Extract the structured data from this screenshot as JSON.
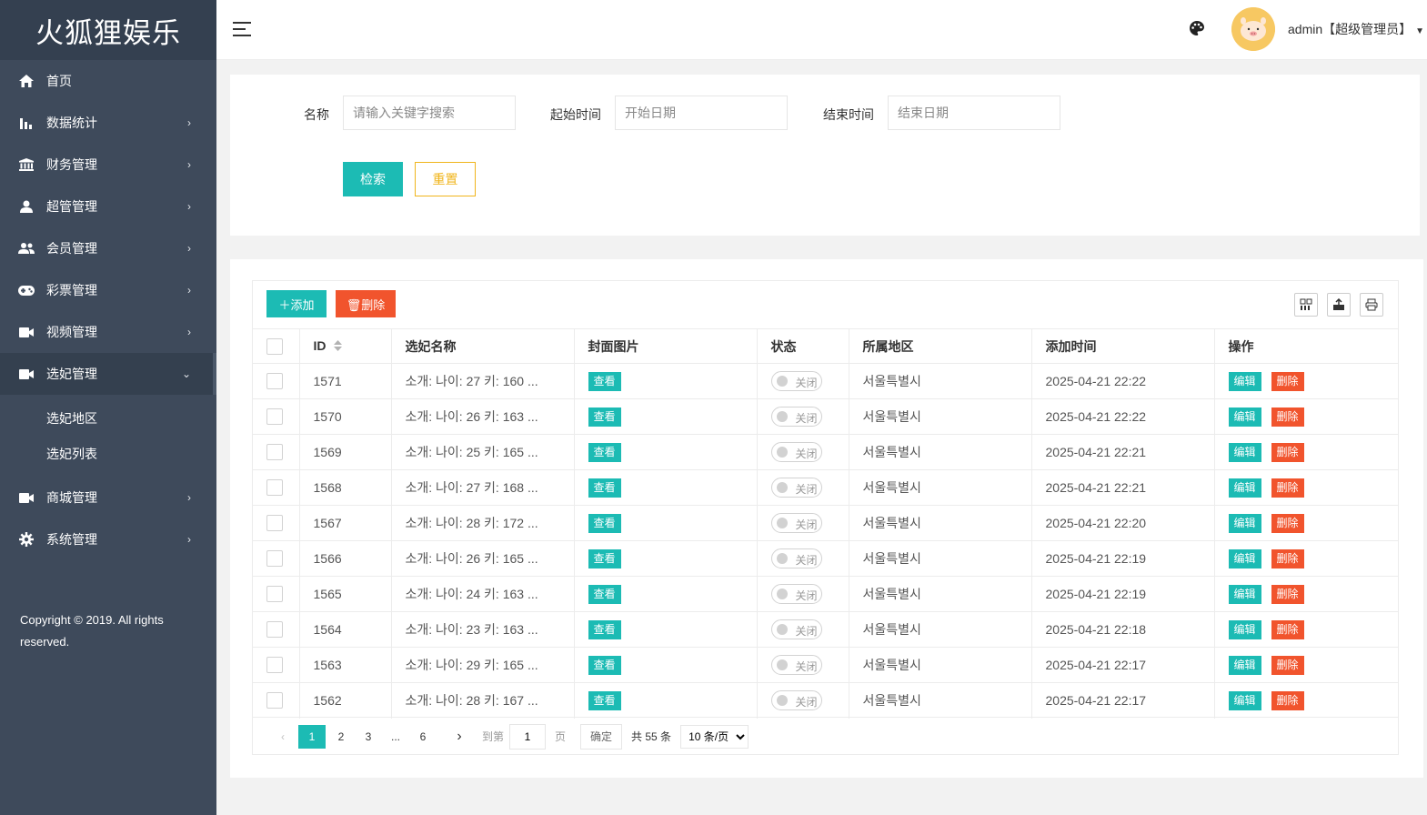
{
  "brand": {
    "title": "火狐狸娱乐"
  },
  "sidebar": {
    "items": [
      {
        "label": "首页",
        "icon": "home-icon"
      },
      {
        "label": "数据统计",
        "icon": "bar-chart-icon"
      },
      {
        "label": "财务管理",
        "icon": "bank-icon"
      },
      {
        "label": "超管管理",
        "icon": "user-icon"
      },
      {
        "label": "会员管理",
        "icon": "users-icon"
      },
      {
        "label": "彩票管理",
        "icon": "gamepad-icon"
      },
      {
        "label": "视频管理",
        "icon": "video-icon"
      },
      {
        "label": "选妃管理",
        "icon": "video-icon"
      }
    ],
    "sub_items": [
      {
        "label": "选妃地区"
      },
      {
        "label": "选妃列表"
      }
    ],
    "items_after": [
      {
        "label": "商城管理",
        "icon": "video-icon"
      },
      {
        "label": "系统管理",
        "icon": "gear-icon"
      }
    ],
    "copyright": "Copyright © 2019. All rights reserved."
  },
  "header": {
    "user": "admin【超级管理员】"
  },
  "search": {
    "name_label": "名称",
    "name_placeholder": "请输入关键字搜索",
    "start_label": "起始时间",
    "start_placeholder": "开始日期",
    "end_label": "结束时间",
    "end_placeholder": "结束日期",
    "search_button": "检索",
    "reset_button": "重置"
  },
  "toolbar": {
    "add_label": "添加",
    "delete_label": "删除"
  },
  "table": {
    "columns": [
      "ID",
      "选妃名称",
      "封面图片",
      "状态",
      "所属地区",
      "添加时间",
      "操作"
    ],
    "view_label": "查看",
    "status_label": "关闭",
    "edit_label": "编辑",
    "remove_label": "删除",
    "rows": [
      {
        "id": "1571",
        "name": "소개: 나이: 27 키: 160 ...",
        "region": "서울특별시",
        "time": "2025-04-21 22:22"
      },
      {
        "id": "1570",
        "name": "소개: 나이: 26 키: 163 ...",
        "region": "서울특별시",
        "time": "2025-04-21 22:22"
      },
      {
        "id": "1569",
        "name": "소개: 나이: 25 키: 165 ...",
        "region": "서울특별시",
        "time": "2025-04-21 22:21"
      },
      {
        "id": "1568",
        "name": "소개: 나이: 27 키: 168 ...",
        "region": "서울특별시",
        "time": "2025-04-21 22:21"
      },
      {
        "id": "1567",
        "name": "소개: 나이: 28 키: 172 ...",
        "region": "서울특별시",
        "time": "2025-04-21 22:20"
      },
      {
        "id": "1566",
        "name": "소개: 나이: 26 키: 165 ...",
        "region": "서울특별시",
        "time": "2025-04-21 22:19"
      },
      {
        "id": "1565",
        "name": "소개: 나이: 24 키: 163 ...",
        "region": "서울특별시",
        "time": "2025-04-21 22:19"
      },
      {
        "id": "1564",
        "name": "소개: 나이: 23 키: 163 ...",
        "region": "서울특별시",
        "time": "2025-04-21 22:18"
      },
      {
        "id": "1563",
        "name": "소개: 나이: 29 키: 165 ...",
        "region": "서울특별시",
        "time": "2025-04-21 22:17"
      },
      {
        "id": "1562",
        "name": "소개: 나이: 28 키: 167 ...",
        "region": "서울특별시",
        "time": "2025-04-21 22:17"
      }
    ]
  },
  "pager": {
    "current": "1",
    "pages": [
      "2",
      "3",
      "6"
    ],
    "ellipsis": "...",
    "goto_label": "到第",
    "goto_value": "1",
    "page_unit": "页",
    "confirm": "确定",
    "total": "共 55 条",
    "per_page": "10 条/页"
  },
  "colors": {
    "accent": "#1cbbb4",
    "danger": "#f1542d",
    "warn": "#f0b51c",
    "sidebar": "#3e4a5b"
  }
}
